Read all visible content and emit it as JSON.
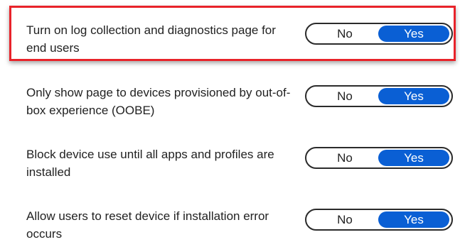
{
  "settings": [
    {
      "label": "Turn on log collection and diagnostics page for end users",
      "options": [
        "No",
        "Yes"
      ],
      "selected": "Yes",
      "highlighted": true
    },
    {
      "label": "Only show page to devices provisioned by out-of-box experience (OOBE)",
      "options": [
        "No",
        "Yes"
      ],
      "selected": "Yes",
      "highlighted": false
    },
    {
      "label": "Block device use until all apps and profiles are installed",
      "options": [
        "No",
        "Yes"
      ],
      "selected": "Yes",
      "highlighted": false
    },
    {
      "label": "Allow users to reset device if installation error occurs",
      "options": [
        "No",
        "Yes"
      ],
      "selected": "Yes",
      "highlighted": false
    }
  ],
  "colors": {
    "highlight_border": "#e8232a",
    "selected_pill": "#0a5fd4",
    "toggle_border": "#2b2b2b"
  }
}
